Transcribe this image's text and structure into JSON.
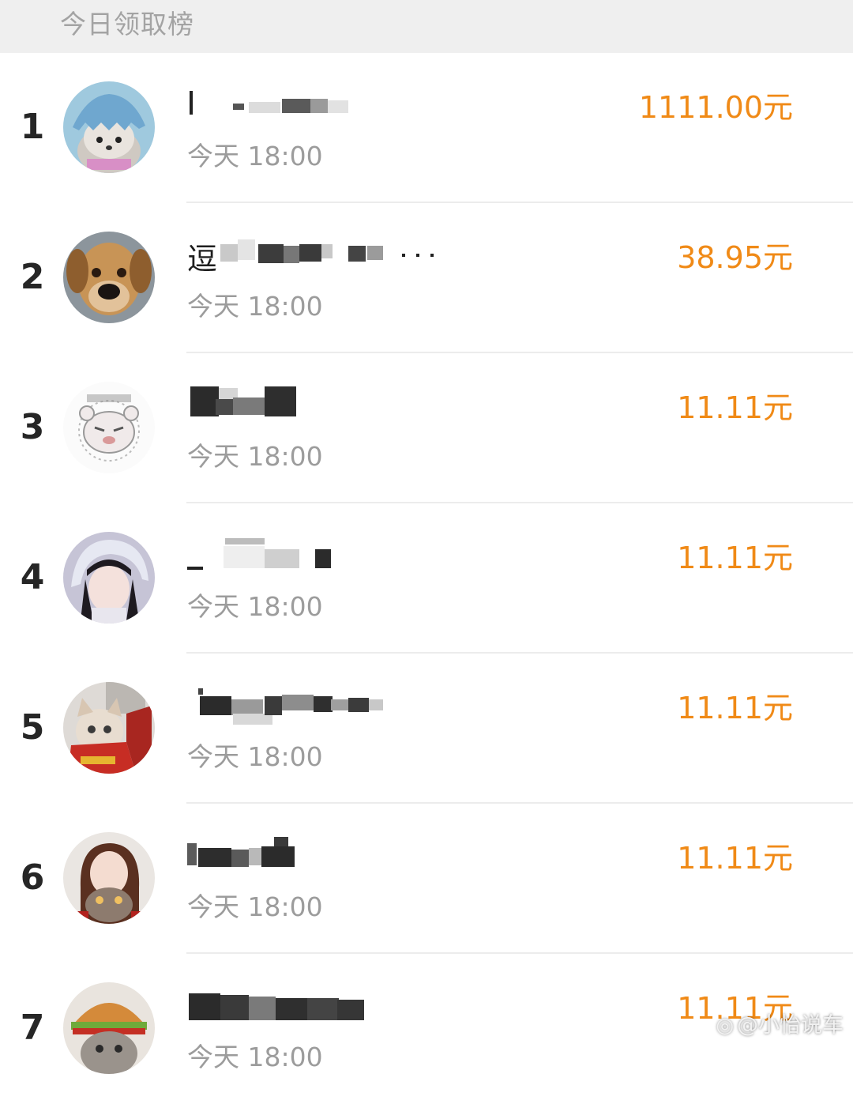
{
  "header": {
    "title": "今日领取榜"
  },
  "rows": [
    {
      "rank": "1",
      "name": "",
      "time": "今天 18:00",
      "amount": "1111.00元"
    },
    {
      "rank": "2",
      "name": "逗",
      "time": "今天 18:00",
      "amount": "38.95元"
    },
    {
      "rank": "3",
      "name": "",
      "time": "今天 18:00",
      "amount": "11.11元"
    },
    {
      "rank": "4",
      "name": "",
      "time": "今天 18:00",
      "amount": "11.11元"
    },
    {
      "rank": "5",
      "name": "",
      "time": "今天 18:00",
      "amount": "11.11元"
    },
    {
      "rank": "6",
      "name": "",
      "time": "今天 18:00",
      "amount": "11.11元"
    },
    {
      "rank": "7",
      "name": "",
      "time": "今天 18:00",
      "amount": "11.11元"
    }
  ],
  "watermark": {
    "text": "@小怡说车",
    "icon": "weibo-icon"
  },
  "colors": {
    "amount": "#f08a17",
    "header_bg": "#efefef",
    "time": "#9c9c9c"
  }
}
